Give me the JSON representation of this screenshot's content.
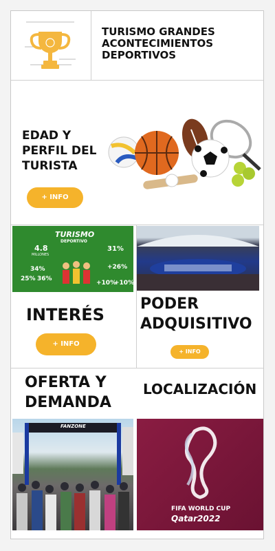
{
  "header": {
    "title": "TURISMO GRANDES ACONTECIMIENTOS DEPORTIVOS"
  },
  "section1": {
    "title": "EDAD Y PERFIL DEL TURISTA",
    "button": "+ INFO"
  },
  "poster": {
    "title": "TURISMO",
    "subtitle": "DEPORTIVO",
    "stats": [
      {
        "value": "4.8",
        "unit": "MILLONES"
      },
      {
        "value": "31%"
      },
      {
        "value": "34%"
      },
      {
        "value": "+26%"
      },
      {
        "value": "25%"
      },
      {
        "value": "36%"
      },
      {
        "value": "+10%"
      },
      {
        "value": "+10%"
      }
    ]
  },
  "section2": {
    "title": "INTERÉS",
    "button": "+ INFO"
  },
  "section3": {
    "title": "PODER ADQUISITIVO",
    "button": "+ INFO"
  },
  "section4": {
    "title": "OFERTA Y DEMANDA",
    "sign": "FANZONE"
  },
  "section5": {
    "title": "LOCALIZACIÓN",
    "logo_line1": "FIFA WORLD CUP",
    "logo_line2": "Qatar2022"
  },
  "colors": {
    "accent": "#f5b32b",
    "trophy": "#f4b73f",
    "qatar": "#7a1838"
  }
}
